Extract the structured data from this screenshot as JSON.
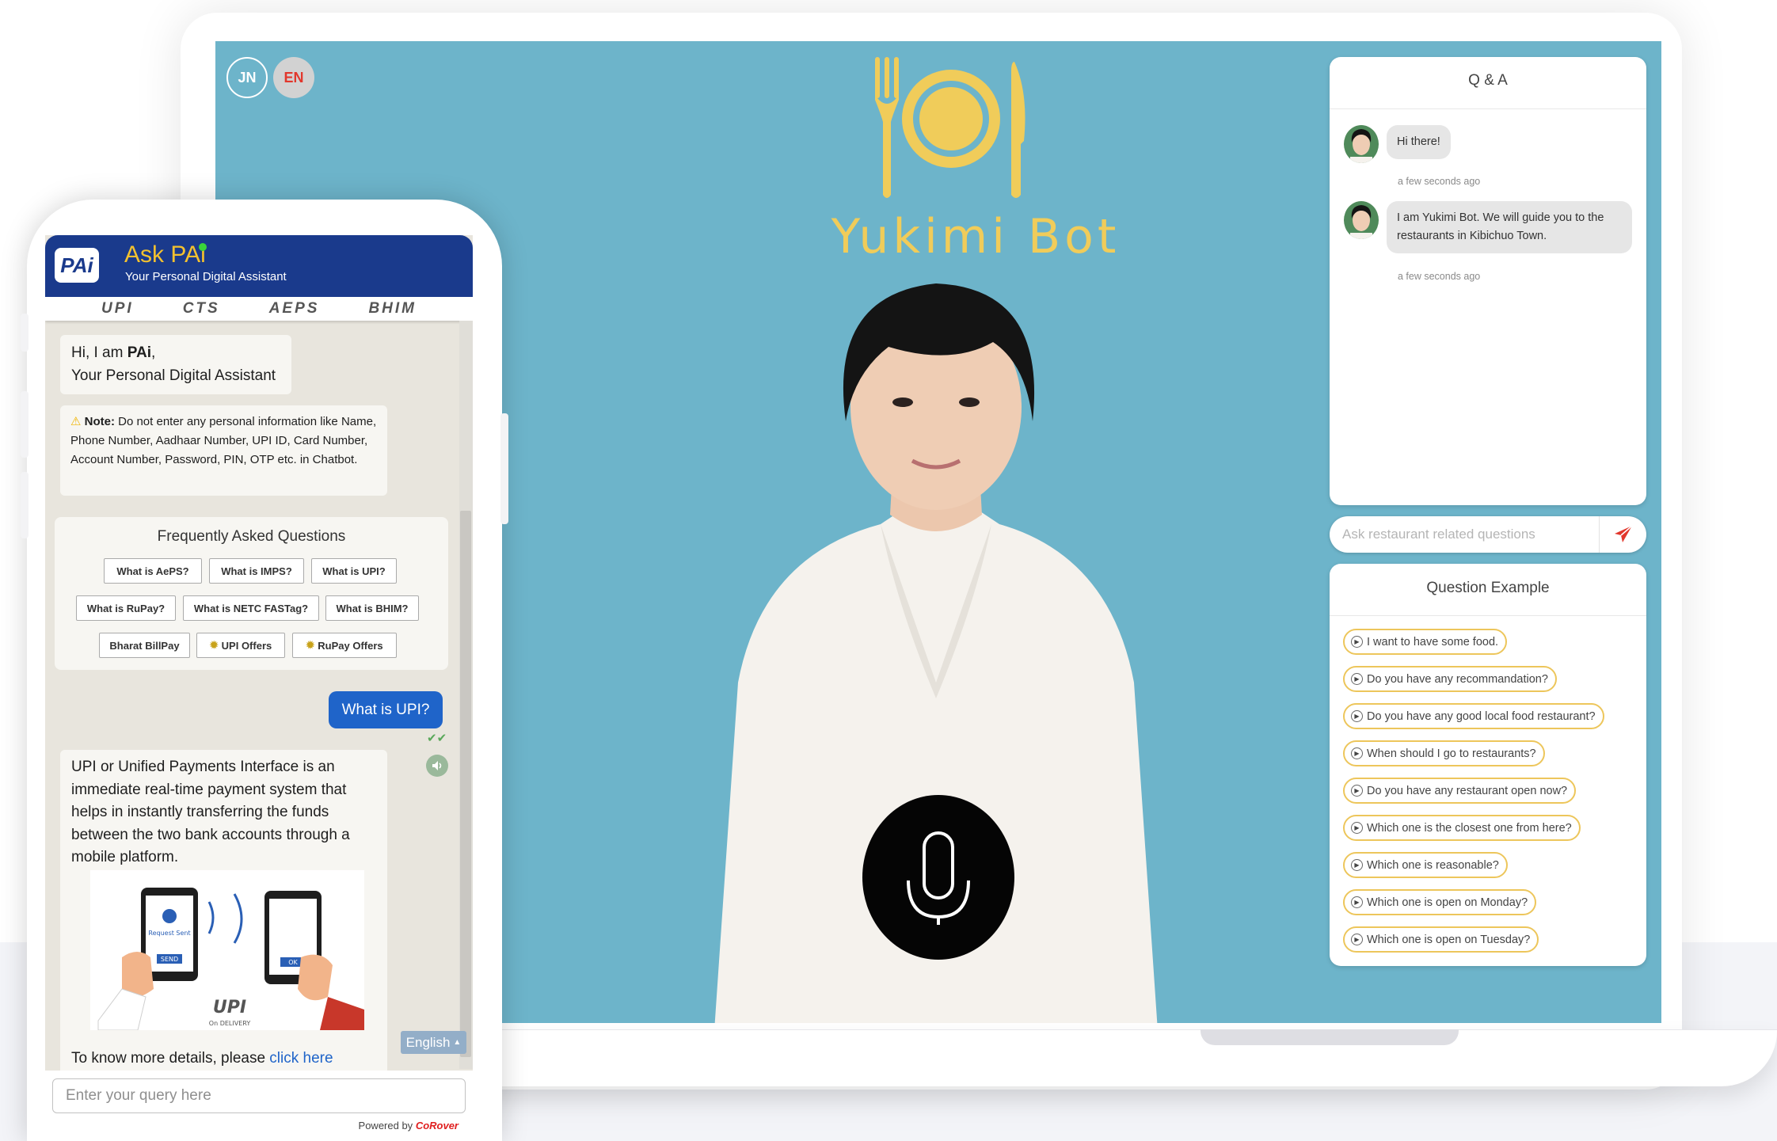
{
  "colors": {
    "screen_bg": "#6db4ca",
    "accent_yellow": "#f0cc5a",
    "chip_border": "#edc65b",
    "phone_header": "#1a3a8c",
    "user_bubble": "#1f64c9"
  },
  "yukimi": {
    "lang_buttons": [
      "JN",
      "EN"
    ],
    "title": "Yukimi Bot",
    "qa": {
      "title": "Q & A",
      "messages": [
        {
          "text": "Hi there!",
          "time": "a few seconds ago"
        },
        {
          "text": "I am Yukimi Bot. We will guide you to the restaurants in Kibichuo Town.",
          "time": "a few seconds ago"
        }
      ]
    },
    "ask_placeholder": "Ask restaurant related questions",
    "examples": {
      "title": "Question Example",
      "items": [
        "I want to have some food.",
        "Do you have any recommandation?",
        "Do you have any good local food restaurant?",
        "When should I go to restaurants?",
        "Do you have any restaurant open now?",
        "Which one is the closest one from here?",
        "Which one is reasonable?",
        "Which one is open on Monday?",
        "Which one is open on Tuesday?"
      ]
    }
  },
  "pai": {
    "badge": "PAi",
    "title": "Ask PAi",
    "subtitle": "Your Personal Digital Assistant",
    "partner_logos": [
      "UPI",
      "CTS",
      "AEPS",
      "BHIM"
    ],
    "greeting": {
      "line1_prefix": "Hi, I am ",
      "line1_bold": "PAi",
      "line1_suffix": ",",
      "line2": "Your Personal Digital Assistant"
    },
    "note": {
      "label": "Note:",
      "text": "Do not enter any personal information like Name, Phone Number, Aadhaar Number, UPI ID, Card Number, Account Number, Password, PIN, OTP etc. in Chatbot."
    },
    "faq": {
      "title": "Frequently Asked Questions",
      "buttons": [
        "What is AePS?",
        "What is IMPS?",
        "What is UPI?",
        "What is RuPay?",
        "What is NETC FASTag?",
        "What is BHIM?",
        "Bharat BillPay",
        "UPI Offers",
        "RuPay Offers"
      ]
    },
    "user_message": "What is UPI?",
    "bot_answer": "UPI or Unified Payments Interface is an immediate real-time payment system that helps in instantly transferring the funds between the two bank accounts through a mobile platform.",
    "illustration": {
      "left_phone_text": "Request Sent",
      "left_btn": "SEND",
      "right_btn": "OK",
      "logo": "UPI",
      "logo_sub": "On DELIVERY"
    },
    "more": {
      "prefix": "To know more details, please ",
      "link": "click here"
    },
    "language": "English",
    "input_placeholder": "Enter your query here",
    "powered_prefix": "Powered by",
    "powered_brand": "CoRover"
  }
}
